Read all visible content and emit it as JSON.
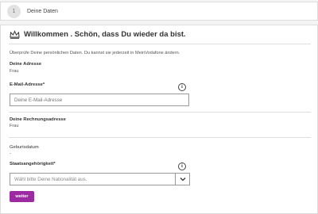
{
  "step": {
    "number": "1",
    "label": "Deine Daten"
  },
  "welcome": {
    "title": "Willkommen . Schön, dass Du wieder da bist."
  },
  "intro": "Überprüfe Deine persönlichen Daten. Du kannst sie jederzeit in MeinVodafone ändern.",
  "address": {
    "label": "Deine Adresse",
    "value": "Frau"
  },
  "email": {
    "label": "E-Mail-Adresse*",
    "placeholder": "Deine E-Mail-Adresse"
  },
  "billing": {
    "label": "Deine Rechnungsadresse",
    "value": "Frau"
  },
  "birthdate": {
    "label": "Geburtsdatum",
    "value": "-"
  },
  "nationality": {
    "label": "Staatsangehörigkeit*",
    "placeholder": "Wähl bitte Deine Nationalität aus."
  },
  "info_icon": {
    "glyph": "i"
  },
  "submit": {
    "label": "weiter"
  },
  "colors": {
    "brand": "#9c2aa0"
  },
  "icons": [
    "crown-icon",
    "info-icon",
    "chevron-down-icon"
  ]
}
